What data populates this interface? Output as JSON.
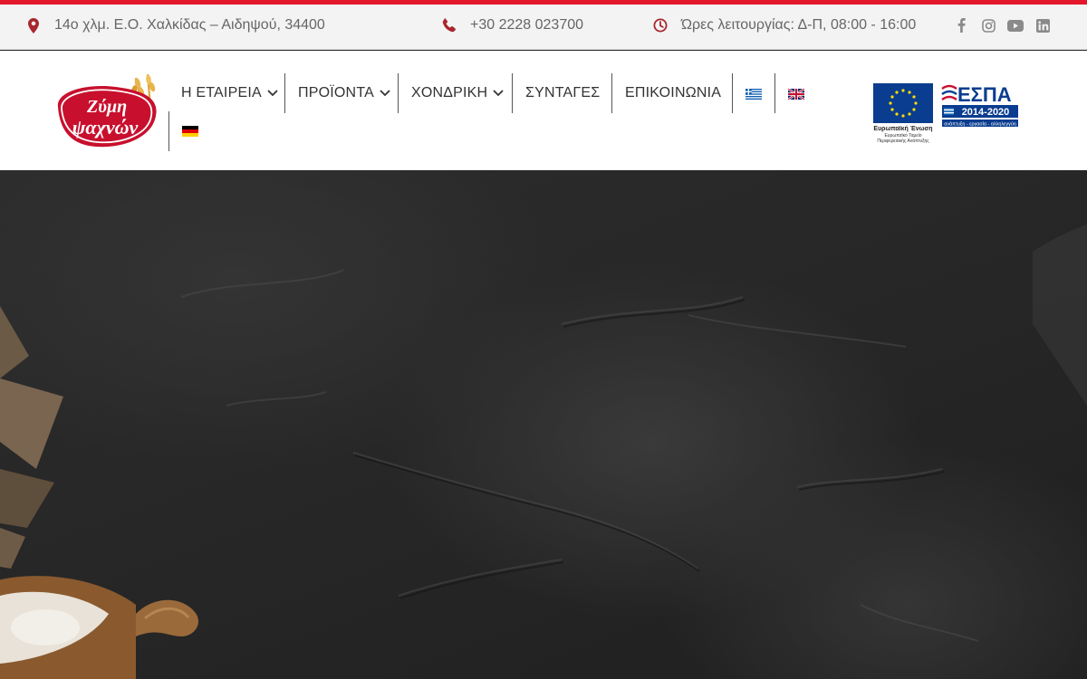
{
  "topbar": {
    "address": "14ο χλμ. Ε.Ο. Χαλκίδας – Αιδηψού, 34400",
    "phone": "+30 2228 023700",
    "hours": "Ώρες λειτουργίας: Δ-Π, 08:00 - 16:00",
    "icons": {
      "address": "map-marker-icon",
      "phone": "phone-icon",
      "hours": "clock-icon"
    },
    "socials": [
      "facebook-icon",
      "instagram-icon",
      "youtube-icon",
      "linkedin-icon"
    ]
  },
  "logo": {
    "line1": "Ζύμη",
    "line2": "ψαχνών"
  },
  "nav": {
    "items": [
      {
        "label": "Η ΕΤΑΙΡΕΙΑ",
        "has_dropdown": true
      },
      {
        "label": "ΠΡΟΪΟΝΤΑ",
        "has_dropdown": true
      },
      {
        "label": "ΧΟΝΔΡΙΚΗ",
        "has_dropdown": true
      },
      {
        "label": "ΣΥΝΤΑΓΕΣ",
        "has_dropdown": false
      },
      {
        "label": "ΕΠΙΚΟΙΝΩΝΙΑ",
        "has_dropdown": false
      }
    ],
    "languages": [
      "greek-flag-icon",
      "uk-flag-icon",
      "german-flag-icon"
    ]
  },
  "espa": {
    "title": "ΕΣΠΑ",
    "years": "2014-2020",
    "eu_title": "Ευρωπαϊκή Ένωση",
    "eu_fund_line1": "Ευρωπαϊκό Ταμείο",
    "eu_fund_line2": "Περιφερειακής Ανάπτυξης",
    "tagline": "ανάπτυξη - εργασία - αλληλεγγύη"
  },
  "colors": {
    "accent": "#e2172a",
    "topbar_bg": "#f3f3f3",
    "icon_red": "#a8272e",
    "text_muted": "#666666",
    "nav_text": "#333333",
    "eu_blue": "#0a3d8f",
    "hero_bg": "#262626"
  }
}
